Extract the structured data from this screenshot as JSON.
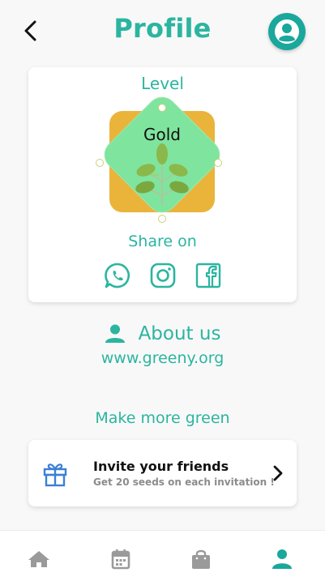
{
  "header": {
    "title": "Profile",
    "back_icon": "chevron-left-icon",
    "avatar_icon": "user-circle-icon"
  },
  "level_card": {
    "label": "Level",
    "badge_text": "Gold",
    "badge_icon": "leaf-plant-icon",
    "share_label": "Share on",
    "share_icons": [
      "whatsapp-icon",
      "instagram-icon",
      "facebook-icon"
    ]
  },
  "about": {
    "label": "About us",
    "icon": "person-icon",
    "website": "www.greeny.org"
  },
  "make_more": {
    "label": "Make more green"
  },
  "invite": {
    "title": "Invite your friends",
    "subtitle": "Get 20 seeds on each invitation !",
    "icon": "gift-icon",
    "arrow_icon": "chevron-right-icon"
  },
  "bottom_nav": {
    "items": [
      "home-icon",
      "calendar-icon",
      "bag-icon",
      "person-icon"
    ],
    "active": "person-icon"
  },
  "colors": {
    "accent": "#2bb5a0",
    "avatar_bg": "#1aa79c",
    "badge_gold": "#eab43b",
    "badge_green": "#7fe49e",
    "nav_inactive": "#9a9a9a",
    "gift_blue": "#3b7fd6"
  }
}
